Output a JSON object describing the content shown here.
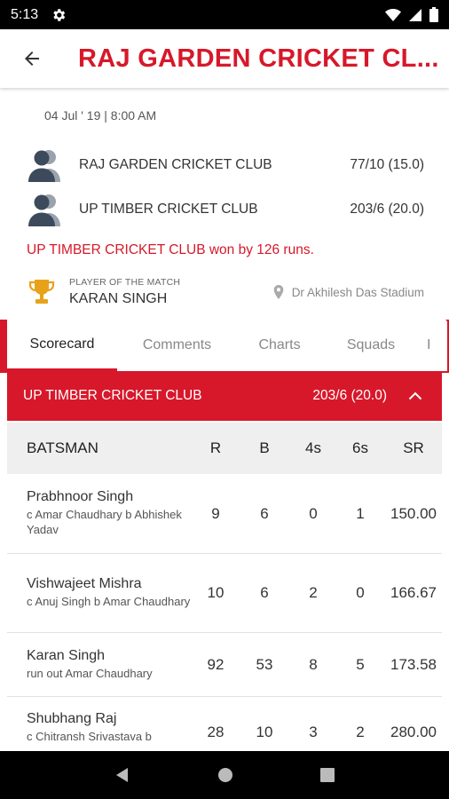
{
  "status_bar": {
    "time": "5:13"
  },
  "app_bar": {
    "title": "RAJ GARDEN CRICKET CL..."
  },
  "match": {
    "date": "04 Jul ' 19 | 8:00 AM",
    "teams": [
      {
        "name": "RAJ GARDEN CRICKET CLUB",
        "score": "77/10 (15.0)"
      },
      {
        "name": "UP TIMBER CRICKET CLUB",
        "score": "203/6 (20.0)"
      }
    ],
    "result": "UP TIMBER CRICKET CLUB won by 126 runs.",
    "player_of_match_label": "PLAYER OF THE MATCH",
    "player_of_match": "KARAN SINGH",
    "venue": "Dr Akhilesh Das Stadium"
  },
  "tabs": [
    {
      "label": "Scorecard",
      "active": true
    },
    {
      "label": "Comments"
    },
    {
      "label": "Charts"
    },
    {
      "label": "Squads"
    },
    {
      "label": "I"
    }
  ],
  "innings": {
    "team": "UP TIMBER CRICKET CLUB",
    "score": "203/6 (20.0)"
  },
  "batting": {
    "headers": [
      "BATSMAN",
      "R",
      "B",
      "4s",
      "6s",
      "SR"
    ],
    "rows": [
      {
        "name": "Prabhnoor Singh",
        "dismissal": "c Amar Chaudhary b Abhishek Yadav",
        "r": "9",
        "b": "6",
        "fours": "0",
        "sixes": "1",
        "sr": "150.00"
      },
      {
        "name": "Vishwajeet Mishra",
        "dismissal": "c Anuj Singh b Amar Chaudhary",
        "r": "10",
        "b": "6",
        "fours": "2",
        "sixes": "0",
        "sr": "166.67"
      },
      {
        "name": "Karan Singh",
        "dismissal": "run out Amar Chaudhary",
        "r": "92",
        "b": "53",
        "fours": "8",
        "sixes": "5",
        "sr": "173.58"
      },
      {
        "name": "Shubhang Raj",
        "dismissal": "c Chitransh Srivastava b",
        "r": "28",
        "b": "10",
        "fours": "3",
        "sixes": "2",
        "sr": "280.00"
      }
    ]
  },
  "colors": {
    "accent": "#d7182a",
    "header_bg": "#efefef"
  }
}
